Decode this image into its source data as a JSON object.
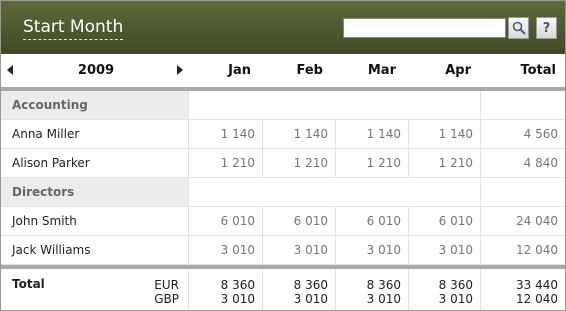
{
  "header": {
    "title": "Start Month",
    "search": {
      "value": "",
      "placeholder": ""
    },
    "help_label": "?"
  },
  "columns": {
    "year": "2009",
    "months": [
      "Jan",
      "Feb",
      "Mar",
      "Apr"
    ],
    "total": "Total"
  },
  "groups": [
    {
      "name": "Accounting",
      "rows": [
        {
          "name": "Anna Miller",
          "values": [
            "1 140",
            "1 140",
            "1 140",
            "1 140"
          ],
          "total": "4 560"
        },
        {
          "name": "Alison Parker",
          "values": [
            "1 210",
            "1 210",
            "1 210",
            "1 210"
          ],
          "total": "4 840"
        }
      ]
    },
    {
      "name": "Directors",
      "rows": [
        {
          "name": "John Smith",
          "values": [
            "6 010",
            "6 010",
            "6 010",
            "6 010"
          ],
          "total": "24 040"
        },
        {
          "name": "Jack Williams",
          "values": [
            "3 010",
            "3 010",
            "3 010",
            "3 010"
          ],
          "total": "12 040"
        }
      ]
    }
  ],
  "footer": {
    "label": "Total",
    "currencies": [
      "EUR",
      "GBP"
    ],
    "eur_values": [
      "8 360",
      "8 360",
      "8 360",
      "8 360"
    ],
    "gbp_values": [
      "3 010",
      "3 010",
      "3 010",
      "3 010"
    ],
    "eur_total": "33 440",
    "gbp_total": "12 040"
  },
  "colors": {
    "header_bg": "#4f5a30",
    "group_bg": "#ececec",
    "separator": "#a9a9a9"
  },
  "icons": {
    "search_button": "magnifier-icon",
    "prev_year": "triangle-left-icon",
    "next_year": "triangle-right-icon"
  }
}
